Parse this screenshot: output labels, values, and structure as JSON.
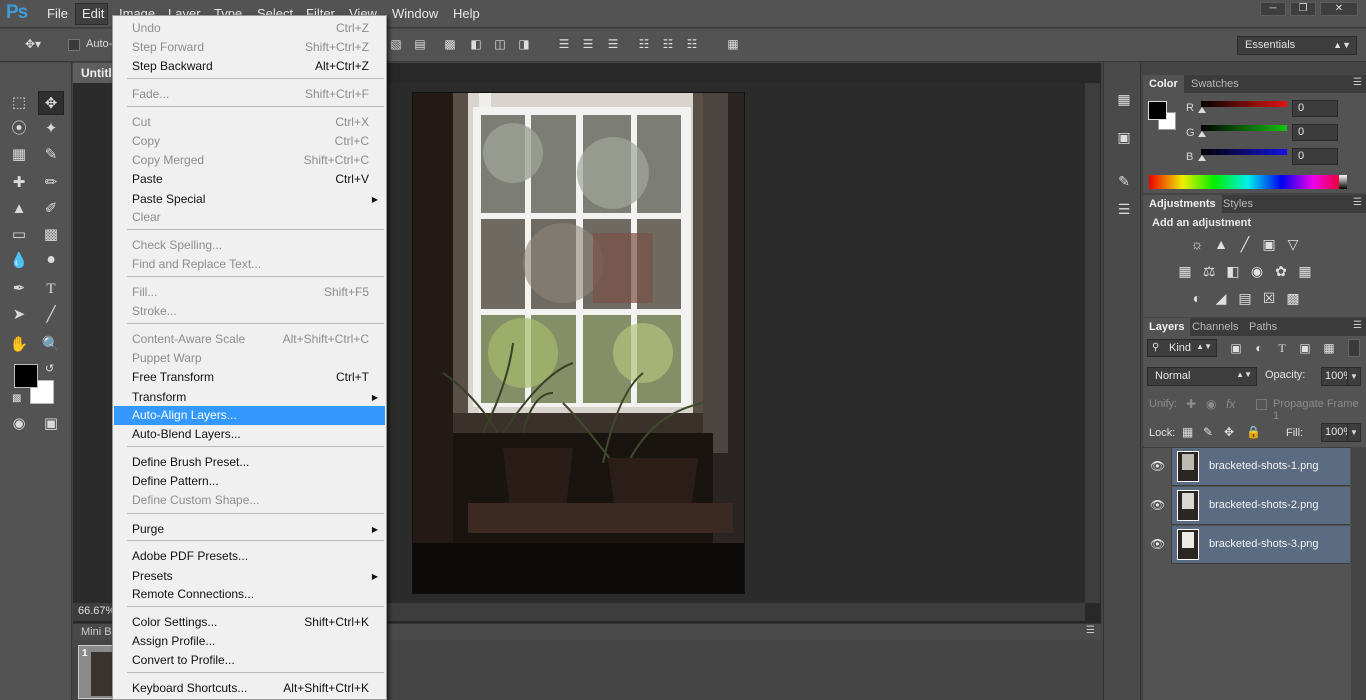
{
  "app": {
    "logo": "Ps"
  },
  "menubar": {
    "items": [
      "File",
      "Edit",
      "Image",
      "Layer",
      "Type",
      "Select",
      "Filter",
      "View",
      "Window",
      "Help"
    ]
  },
  "options_bar": {
    "auto_select_label": "Auto-",
    "workspace": "Essentials"
  },
  "document": {
    "tab_title": "Untitl",
    "zoom": "66.67%"
  },
  "mini_bridge": {
    "label": "Mini B",
    "thumb_number": "1"
  },
  "color_panel": {
    "tabs": [
      "Color",
      "Swatches"
    ],
    "r_label": "R",
    "g_label": "G",
    "b_label": "B",
    "r_value": "0",
    "g_value": "0",
    "b_value": "0",
    "r_color": "#e01414",
    "g_color": "#14c014",
    "b_color": "#1414e0"
  },
  "adjustments_panel": {
    "tabs": [
      "Adjustments",
      "Styles"
    ],
    "heading": "Add an adjustment"
  },
  "layers_panel": {
    "tabs": [
      "Layers",
      "Channels",
      "Paths"
    ],
    "kind_label": "Kind",
    "blend_mode": "Normal",
    "opacity_label": "Opacity:",
    "opacity_value": "100%",
    "unify_label": "Unify:",
    "propagate_label": "Propagate Frame 1",
    "lock_label": "Lock:",
    "fill_label": "Fill:",
    "fill_value": "100%",
    "layers": [
      {
        "name": "bracketed-shots-1.png"
      },
      {
        "name": "bracketed-shots-2.png"
      },
      {
        "name": "bracketed-shots-3.png"
      }
    ]
  },
  "edit_menu": {
    "items": [
      {
        "label": "Undo",
        "shortcut": "Ctrl+Z",
        "disabled": true
      },
      {
        "label": "Step Forward",
        "shortcut": "Shift+Ctrl+Z",
        "disabled": true
      },
      {
        "label": "Step Backward",
        "shortcut": "Alt+Ctrl+Z",
        "disabled": false
      },
      {
        "label": "Fade...",
        "shortcut": "Shift+Ctrl+F",
        "disabled": true
      },
      {
        "label": "Cut",
        "shortcut": "Ctrl+X",
        "disabled": true
      },
      {
        "label": "Copy",
        "shortcut": "Ctrl+C",
        "disabled": true
      },
      {
        "label": "Copy Merged",
        "shortcut": "Shift+Ctrl+C",
        "disabled": true
      },
      {
        "label": "Paste",
        "shortcut": "Ctrl+V",
        "disabled": false
      },
      {
        "label": "Paste Special",
        "shortcut": "",
        "disabled": false,
        "submenu": true
      },
      {
        "label": "Clear",
        "shortcut": "",
        "disabled": true
      },
      {
        "label": "Check Spelling...",
        "shortcut": "",
        "disabled": true
      },
      {
        "label": "Find and Replace Text...",
        "shortcut": "",
        "disabled": true
      },
      {
        "label": "Fill...",
        "shortcut": "Shift+F5",
        "disabled": true
      },
      {
        "label": "Stroke...",
        "shortcut": "",
        "disabled": true
      },
      {
        "label": "Content-Aware Scale",
        "shortcut": "Alt+Shift+Ctrl+C",
        "disabled": true
      },
      {
        "label": "Puppet Warp",
        "shortcut": "",
        "disabled": true
      },
      {
        "label": "Free Transform",
        "shortcut": "Ctrl+T",
        "disabled": false
      },
      {
        "label": "Transform",
        "shortcut": "",
        "disabled": false,
        "submenu": true
      },
      {
        "label": "Auto-Align Layers...",
        "shortcut": "",
        "disabled": false,
        "highlighted": true
      },
      {
        "label": "Auto-Blend Layers...",
        "shortcut": "",
        "disabled": false
      },
      {
        "label": "Define Brush Preset...",
        "shortcut": "",
        "disabled": false
      },
      {
        "label": "Define Pattern...",
        "shortcut": "",
        "disabled": false
      },
      {
        "label": "Define Custom Shape...",
        "shortcut": "",
        "disabled": true
      },
      {
        "label": "Purge",
        "shortcut": "",
        "disabled": false,
        "submenu": true
      },
      {
        "label": "Adobe PDF Presets...",
        "shortcut": "",
        "disabled": false
      },
      {
        "label": "Presets",
        "shortcut": "",
        "disabled": false,
        "submenu": true
      },
      {
        "label": "Remote Connections...",
        "shortcut": "",
        "disabled": false
      },
      {
        "label": "Color Settings...",
        "shortcut": "Shift+Ctrl+K",
        "disabled": false
      },
      {
        "label": "Assign Profile...",
        "shortcut": "",
        "disabled": false
      },
      {
        "label": "Convert to Profile...",
        "shortcut": "",
        "disabled": false
      },
      {
        "label": "Keyboard Shortcuts...",
        "shortcut": "Alt+Shift+Ctrl+K",
        "disabled": false
      }
    ]
  }
}
